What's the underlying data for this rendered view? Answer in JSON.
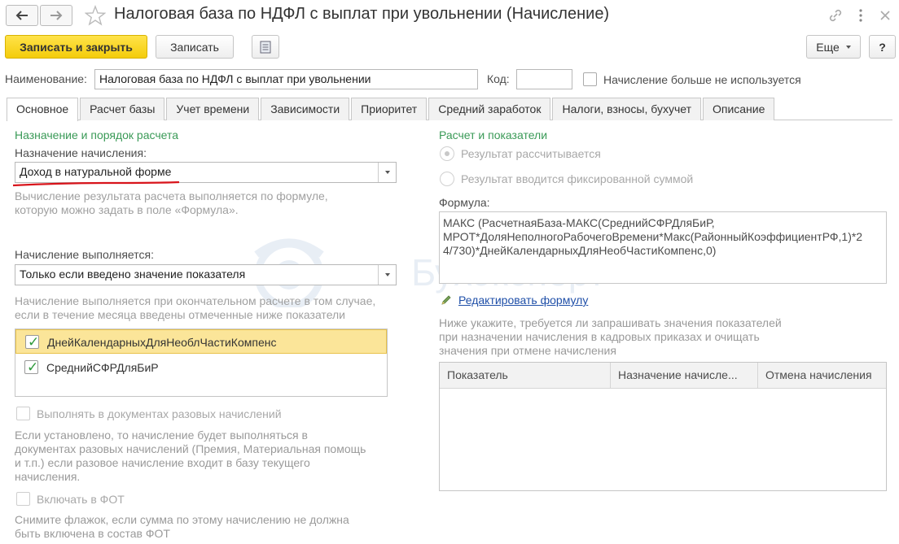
{
  "window": {
    "title": "Налоговая база по НДФЛ с выплат при увольнении (Начисление)"
  },
  "toolbar": {
    "save_close": "Записать и закрыть",
    "save": "Записать",
    "more": "Еще",
    "help": "?"
  },
  "header": {
    "name_label": "Наименование:",
    "name_value": "Налоговая база по НДФЛ с выплат при увольнении",
    "code_label": "Код:",
    "code_value": "",
    "unused_label": "Начисление больше не используется"
  },
  "tabs": [
    {
      "label": "Основное"
    },
    {
      "label": "Расчет базы"
    },
    {
      "label": "Учет времени"
    },
    {
      "label": "Зависимости"
    },
    {
      "label": "Приоритет"
    },
    {
      "label": "Средний заработок"
    },
    {
      "label": "Налоги, взносы, бухучет"
    },
    {
      "label": "Описание"
    }
  ],
  "left": {
    "section_title": "Назначение и порядок расчета",
    "purpose_label": "Назначение начисления:",
    "purpose_value": "Доход в натуральной форме",
    "formula_hint_1": "Вычисление результата расчета выполняется по формуле,",
    "formula_hint_2": "которую можно задать в поле «Формула».",
    "run_label": "Начисление выполняется:",
    "run_value": "Только если введено значение показателя",
    "run_hint_1": "Начисление выполняется при окончательном расчете в том случае,",
    "run_hint_2": "если в течение месяца введены отмеченные ниже показатели",
    "indicators": [
      {
        "label": "ДнейКалендарныхДляНеоблЧастиКомпенс",
        "checked": true
      },
      {
        "label": "СреднийСФРДляБиР",
        "checked": true
      }
    ],
    "one_time_label": "Выполнять в документах разовых начислений",
    "one_time_hint_1": "Если установлено, то начисление будет выполняться в",
    "one_time_hint_2": "документах разовых начислений (Премия, Материальная помощь",
    "one_time_hint_3": "и т.п.) если разовое начисление входит в базу текущего",
    "one_time_hint_4": "начисления.",
    "fot_label": "Включать в ФОТ",
    "fot_hint_1": "Снимите флажок, если сумма по этому начислению не должна",
    "fot_hint_2": "быть включена в состав ФОТ"
  },
  "right": {
    "section_title": "Расчет и показатели",
    "radio_calc": "Результат рассчитывается",
    "radio_fixed": "Результат вводится фиксированной суммой",
    "formula_label": "Формула:",
    "formula_line_1": "МАКС (РасчетнаяБаза-МАКС(СреднийСФРДляБиР,",
    "formula_line_2": "МРОТ*ДоляНеполногоРабочегоВремени*Макс(РайонныйКоэффициентРФ,1)*2",
    "formula_line_3": "4/730)*ДнейКалендарныхДляНеобЧастиКомпенс,0)",
    "edit_formula": "Редактировать формулу",
    "request_hint_1": "Ниже укажите, требуется ли запрашивать значения показателей",
    "request_hint_2": "при назначении начисления в кадровых приказах и очищать",
    "request_hint_3": "значения при отмене начисления",
    "table_headers": [
      "Показатель",
      "Назначение начисле...",
      "Отмена начисления"
    ]
  },
  "watermark": "Бухэксперт",
  "colors": {
    "accent_green": "#3a9a57",
    "primary_button": "#f4cc0b",
    "selected_row": "#fbe599",
    "underline_red": "#d8141b"
  }
}
